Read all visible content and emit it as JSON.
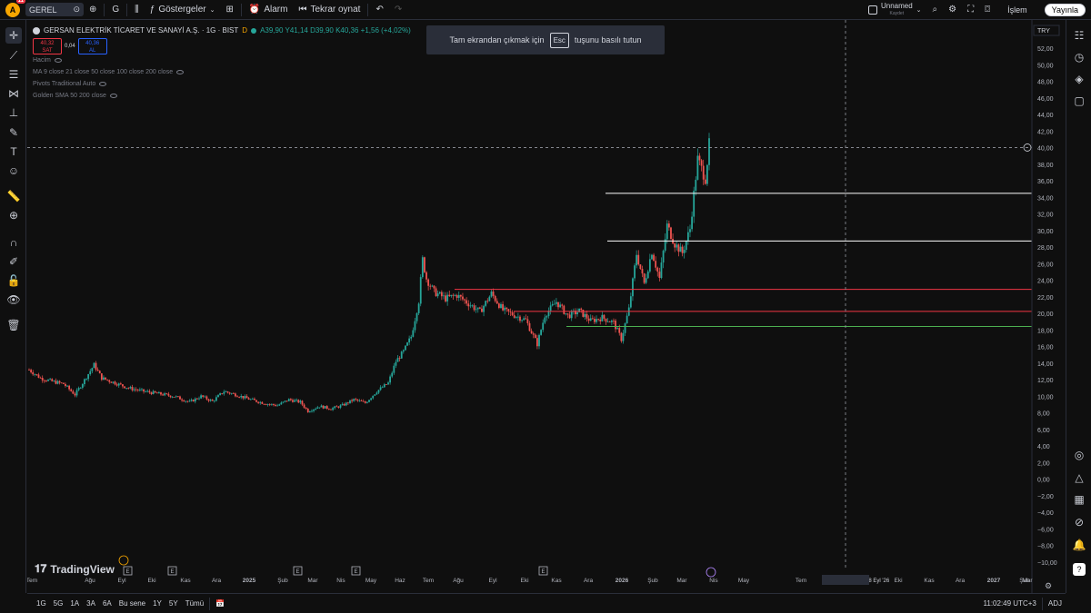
{
  "topbar": {
    "avatar_letter": "A",
    "notification_count": "11",
    "symbol": "GEREL",
    "interval": "G",
    "indicators_label": "Göstergeler",
    "alarm_label": "Alarm",
    "replay_label": "Tekrar oynat",
    "layout_name": "Unnamed",
    "layout_status": "Kaydet",
    "trade_label": "İşlem",
    "publish_label": "Yayınla"
  },
  "legend": {
    "title": "GERSAN ELEKTRİK TİCARET VE SANAYİ A.Ş. · 1G · BIST",
    "d_flag": "D",
    "ohlc": "A39,90  Y41,14  D39,90  K40,36  +1,56 (+4,02%)",
    "sell_price": "40,32",
    "sell_label": "SAT",
    "spread": "0,04",
    "buy_price": "40,36",
    "buy_label": "AL",
    "indicators": [
      "Hacim",
      "MA 9 close 21 close 50 close 100 close 200 close",
      "Pivots Traditional Auto",
      "Golden SMA 50 200 close"
    ]
  },
  "toast": {
    "before": "Tam ekrandan çıkmak için",
    "key": "Esc",
    "after": "tuşunu basılı tutun"
  },
  "currency": "TRY",
  "colors": {
    "up": "#26a69a",
    "down": "#ef5350",
    "red_line": "#f23645",
    "green_line": "#4caf50",
    "white_line": "#ffffff"
  },
  "chart_data": {
    "type": "candlestick",
    "y_ticks": [
      "52,00",
      "50,00",
      "48,00",
      "46,00",
      "44,00",
      "42,00",
      "40,00",
      "38,00",
      "36,00",
      "34,00",
      "32,00",
      "30,00",
      "28,00",
      "26,00",
      "24,00",
      "22,00",
      "20,00",
      "18,00",
      "16,00",
      "14,00",
      "12,00",
      "10,00",
      "8,00",
      "6,00",
      "4,00",
      "2,00",
      "0,00",
      "−2,00",
      "−4,00",
      "−6,00",
      "−8,00",
      "−10,00"
    ],
    "ylim": [
      -10.5,
      53
    ],
    "x_ticks": [
      "Tem",
      "Ağu",
      "Eyl",
      "Eki",
      "Kas",
      "Ara",
      "2025",
      "Şub",
      "Mar",
      "Nis",
      "May",
      "Haz",
      "Tem",
      "Ağu",
      "Eyl",
      "Eki",
      "Kas",
      "Ara",
      "2026",
      "Şub",
      "Mar",
      "Nis",
      "May",
      "Tem",
      "Ağu",
      "Sal 08 Eyl '26",
      "Eki",
      "Kas",
      "Ara",
      "2027",
      "Şub",
      "Mar"
    ],
    "last_price": 40.02,
    "crosshair_price": 40.02,
    "crosshair_date": "Sal 08 Eyl '26",
    "horizontal_lines": [
      {
        "price": 34.5,
        "label": "34,50",
        "color": "white"
      },
      {
        "price": 28.74,
        "label": "28,74",
        "color": "white"
      },
      {
        "price": 22.9,
        "label": "22,90",
        "color": "red"
      },
      {
        "price": 20.24,
        "label": "20,24",
        "color": "red"
      },
      {
        "price": 18.43,
        "label": "18,43",
        "color": "green"
      }
    ],
    "price_path": [
      [
        0,
        13.2
      ],
      [
        3,
        12.2
      ],
      [
        6,
        11.8
      ],
      [
        9,
        11.5
      ],
      [
        12,
        10.2
      ],
      [
        14,
        11.6
      ],
      [
        17,
        13.8
      ],
      [
        19,
        12.2
      ],
      [
        22,
        11.7
      ],
      [
        26,
        11.0
      ],
      [
        30,
        10.6
      ],
      [
        34,
        10.3
      ],
      [
        38,
        10.0
      ],
      [
        42,
        9.3
      ],
      [
        45,
        10.0
      ],
      [
        48,
        9.4
      ],
      [
        51,
        10.6
      ],
      [
        54,
        10.2
      ],
      [
        58,
        9.6
      ],
      [
        62,
        9.1
      ],
      [
        65,
        8.9
      ],
      [
        68,
        9.6
      ],
      [
        71,
        9.3
      ],
      [
        73,
        8.2
      ],
      [
        76,
        8.8
      ],
      [
        79,
        8.5
      ],
      [
        82,
        8.9
      ],
      [
        85,
        9.6
      ],
      [
        88,
        9.2
      ],
      [
        91,
        10.6
      ],
      [
        94,
        11.6
      ],
      [
        96,
        14.2
      ],
      [
        98,
        15.4
      ],
      [
        100,
        17.2
      ],
      [
        102,
        21.5
      ],
      [
        103,
        26.5
      ],
      [
        104,
        24.2
      ],
      [
        106,
        22.6
      ],
      [
        109,
        21.8
      ],
      [
        112,
        22.2
      ],
      [
        115,
        21.2
      ],
      [
        118,
        20.2
      ],
      [
        121,
        22.4
      ],
      [
        124,
        20.4
      ],
      [
        127,
        19.8
      ],
      [
        130,
        19.2
      ],
      [
        133,
        16.3
      ],
      [
        135,
        19.8
      ],
      [
        138,
        21.4
      ],
      [
        141,
        19.7
      ],
      [
        144,
        20.3
      ],
      [
        147,
        19.1
      ],
      [
        150,
        19.5
      ],
      [
        153,
        18.9
      ],
      [
        155,
        16.9
      ],
      [
        157,
        20.5
      ],
      [
        159,
        27.2
      ],
      [
        161,
        23.6
      ],
      [
        163,
        27.5
      ],
      [
        165,
        24.2
      ],
      [
        167,
        30.6
      ],
      [
        169,
        28.4
      ],
      [
        171,
        27.3
      ],
      [
        173,
        30.2
      ],
      [
        175,
        38.6
      ],
      [
        177,
        36.3
      ],
      [
        178,
        40.36
      ]
    ],
    "x_range_days": [
      0,
      178
    ]
  },
  "timeframes": [
    "1G",
    "5G",
    "1A",
    "3A",
    "6A",
    "Bu sene",
    "1Y",
    "5Y",
    "Tümü"
  ],
  "clock": "11:02:49 UTC+3",
  "adj_label": "ADJ",
  "logo_text": "TradingView"
}
